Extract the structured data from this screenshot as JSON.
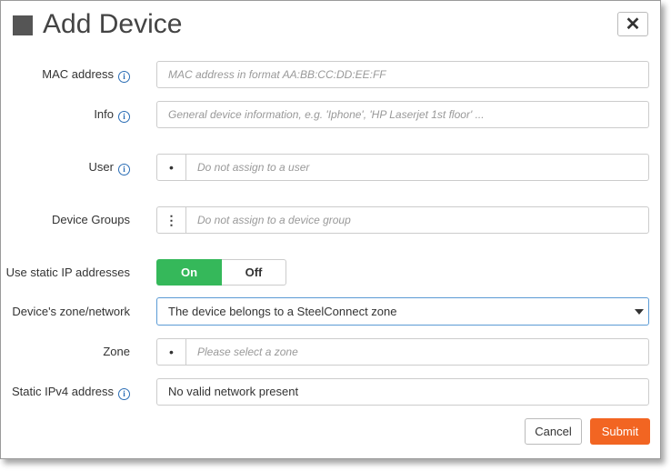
{
  "dialog": {
    "title": "Add Device",
    "close_label": "✕"
  },
  "form": {
    "mac": {
      "label": "MAC address",
      "placeholder": "MAC address in format AA:BB:CC:DD:EE:FF"
    },
    "info": {
      "label": "Info",
      "placeholder": "General device information, e.g. 'Iphone', 'HP Laserjet 1st floor' ..."
    },
    "user": {
      "label": "User",
      "addon": "•",
      "placeholder": "Do not assign to a user"
    },
    "device_groups": {
      "label": "Device Groups",
      "addon": "⋮",
      "placeholder": "Do not assign to a device group"
    },
    "static_ip": {
      "label": "Use static IP addresses",
      "on_label": "On",
      "off_label": "Off",
      "selected": "On"
    },
    "zone_network": {
      "label": "Device's zone/network",
      "value": "The device belongs to a SteelConnect zone"
    },
    "zone": {
      "label": "Zone",
      "addon": "•",
      "placeholder": "Please select a zone"
    },
    "ipv4": {
      "label": "Static IPv4 address",
      "value": "No valid network present"
    },
    "info_icon_glyph": "i"
  },
  "footer": {
    "cancel_label": "Cancel",
    "submit_label": "Submit"
  },
  "colors": {
    "on_green": "#35b85a",
    "submit_orange": "#f26522",
    "info_blue": "#2a6db5",
    "select_focus": "#5b9bd5"
  }
}
